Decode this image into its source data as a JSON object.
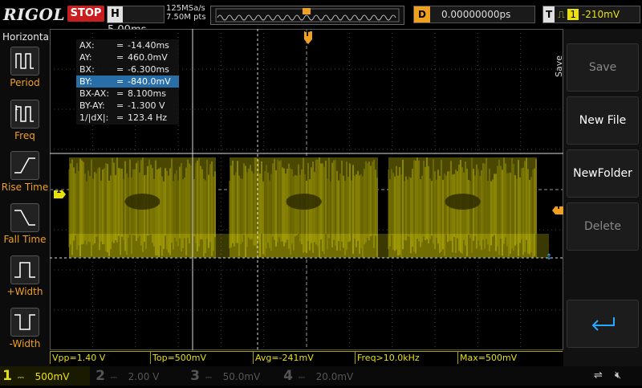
{
  "header": {
    "logo": "RIGOL",
    "run_state": "STOP",
    "timebase_label": "H",
    "timebase": "5.00ms",
    "sample_rate": "125MSa/s",
    "memory_depth": "7.50M pts",
    "delay_label": "D",
    "delay": "0.00000000ps",
    "trigger_label": "T",
    "trigger_source": "1",
    "trigger_level": "-210mV"
  },
  "left_menu": {
    "title": "Horizontal",
    "items": [
      {
        "label": "Period",
        "icon": "period-icon"
      },
      {
        "label": "Freq",
        "icon": "frequency-icon"
      },
      {
        "label": "Rise Time",
        "icon": "rise-time-icon"
      },
      {
        "label": "Fall Time",
        "icon": "fall-time-icon"
      },
      {
        "label": "+Width",
        "icon": "positive-width-icon"
      },
      {
        "label": "-Width",
        "icon": "negative-width-icon"
      }
    ]
  },
  "cursor_panel": {
    "rows": [
      {
        "key": "AX:",
        "value": "-14.40ms"
      },
      {
        "key": "AY:",
        "value": "460.0mV"
      },
      {
        "key": "BX:",
        "value": "-6.300ms"
      },
      {
        "key": "BY:",
        "value": "-840.0mV"
      },
      {
        "key": "BX-AX:",
        "value": "8.100ms"
      },
      {
        "key": "BY-AY:",
        "value": "-1.300 V"
      },
      {
        "key": "1/|dX|:",
        "value": "123.4 Hz"
      }
    ],
    "eq": "="
  },
  "right_menu": {
    "title": "Save",
    "buttons": [
      "Save",
      "New File",
      "NewFolder",
      "Delete"
    ],
    "enter_icon": "enter-return-icon"
  },
  "markers": {
    "trigger_position": "T",
    "channel1": "1",
    "trigger_level": "T"
  },
  "measurements": [
    "Vpp=1.40 V",
    "Top=500mV",
    "Avg=-241mV",
    "Freq>10.0kHz",
    "Max=500mV"
  ],
  "channels": [
    {
      "num": "1",
      "scale": "500mV",
      "color": "#e8e00a",
      "active": true
    },
    {
      "num": "2",
      "scale": "2.00 V",
      "color": "#20c8c8",
      "active": false
    },
    {
      "num": "3",
      "scale": "50.0mV",
      "color": "#d040d0",
      "active": false
    },
    {
      "num": "4",
      "scale": "20.0mV",
      "color": "#3070e0",
      "active": false
    }
  ],
  "status_icons": [
    "usb-icon",
    "speaker-muted-icon"
  ],
  "colors": {
    "ch1": "#e8e00a",
    "trigger": "#f0a020",
    "stop": "#c81e1e"
  }
}
